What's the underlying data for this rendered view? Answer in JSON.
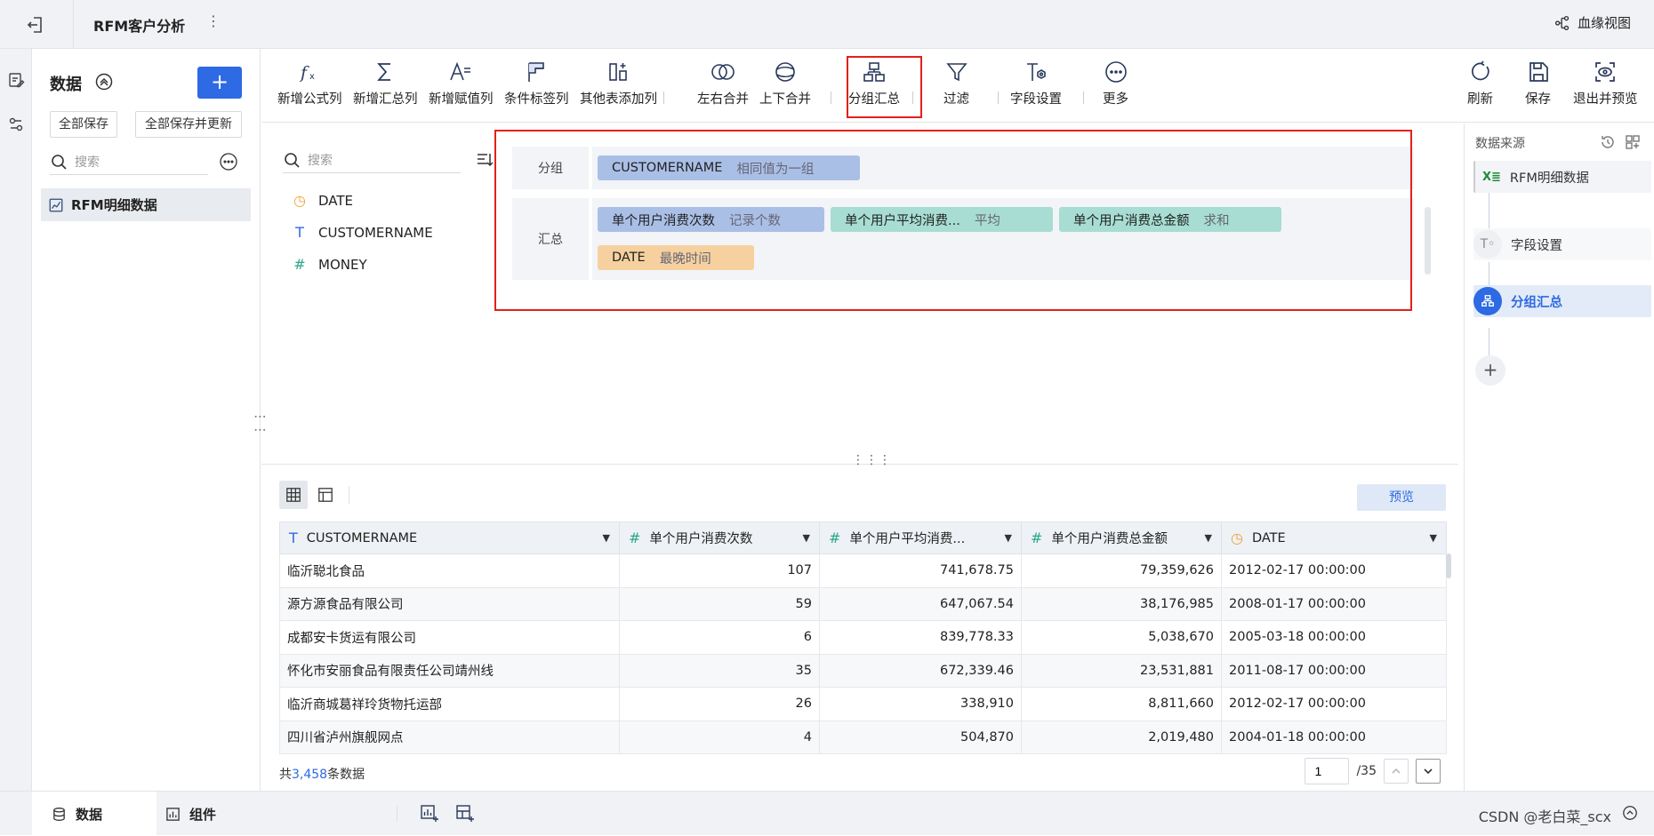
{
  "header": {
    "title": "RFM客户分析",
    "menu": "⋮",
    "lineage_label": "血缘视图"
  },
  "data_panel": {
    "title": "数据",
    "add": "+",
    "save_all": "全部保存",
    "save_all_update": "全部保存并更新",
    "search_placeholder": "搜索",
    "dataset": "RFM明细数据"
  },
  "toolbar": {
    "items": [
      {
        "label": "新增公式列",
        "icon": "formula-icon"
      },
      {
        "label": "新增汇总列",
        "icon": "sigma-icon"
      },
      {
        "label": "新增赋值列",
        "icon": "assign-icon"
      },
      {
        "label": "条件标签列",
        "icon": "flag-icon"
      },
      {
        "label": "其他表添加列",
        "icon": "add-column-icon"
      },
      {
        "label": "左右合并",
        "icon": "left-right-merge-icon"
      },
      {
        "label": "上下合并",
        "icon": "up-down-merge-icon"
      },
      {
        "label": "分组汇总",
        "icon": "group-summary-icon"
      },
      {
        "label": "过滤",
        "icon": "filter-icon"
      },
      {
        "label": "字段设置",
        "icon": "field-settings-icon"
      },
      {
        "label": "更多",
        "icon": "more-icon"
      }
    ],
    "right": [
      {
        "label": "刷新",
        "icon": "refresh-icon"
      },
      {
        "label": "保存",
        "icon": "save-icon"
      },
      {
        "label": "退出并预览",
        "icon": "exit-preview-icon"
      }
    ]
  },
  "fields": {
    "search_placeholder": "搜索",
    "items": [
      {
        "name": "DATE",
        "type": "date"
      },
      {
        "name": "CUSTOMERNAME",
        "type": "text"
      },
      {
        "name": "MONEY",
        "type": "number"
      }
    ]
  },
  "config": {
    "group_label": "分组",
    "group_chip": {
      "field": "CUSTOMERNAME",
      "sub": "相同值为一组"
    },
    "summary_label": "汇总",
    "summary_chips": [
      {
        "field": "单个用户消费次数",
        "sub": "记录个数"
      },
      {
        "field": "单个用户平均消费...",
        "sub": "平均"
      },
      {
        "field": "单个用户消费总金额",
        "sub": "求和"
      },
      {
        "field": "DATE",
        "sub": "最晚时间"
      }
    ]
  },
  "right_panel": {
    "title": "数据来源",
    "steps": [
      "RFM明细数据",
      "字段设置",
      "分组汇总"
    ],
    "add": "+"
  },
  "preview_button": "预览",
  "table": {
    "columns": [
      {
        "label": "CUSTOMERNAME",
        "type": "T"
      },
      {
        "label": "单个用户消费次数",
        "type": "#"
      },
      {
        "label": "单个用户平均消费...",
        "type": "#"
      },
      {
        "label": "单个用户消费总金额",
        "type": "#"
      },
      {
        "label": "DATE",
        "type": "date"
      }
    ],
    "rows": [
      [
        "临沂聪北食品",
        "107",
        "741,678.75",
        "79,359,626",
        "2012-02-17 00:00:00"
      ],
      [
        "源方源食品有限公司",
        "59",
        "647,067.54",
        "38,176,985",
        "2008-01-17 00:00:00"
      ],
      [
        "成都安卡货运有限公司",
        "6",
        "839,778.33",
        "5,038,670",
        "2005-03-18 00:00:00"
      ],
      [
        "怀化市安丽食品有限责任公司靖州线",
        "35",
        "672,339.46",
        "23,531,881",
        "2011-08-17 00:00:00"
      ],
      [
        "临沂商城葛祥玲货物托运部",
        "26",
        "338,910",
        "8,811,660",
        "2012-02-17 00:00:00"
      ],
      [
        "四川省泸州旗舰网点",
        "4",
        "504,870",
        "2,019,480",
        "2004-01-18 00:00:00"
      ]
    ]
  },
  "footer": {
    "prefix": "共",
    "count": "3,458",
    "suffix": "条数据",
    "page": "1",
    "total_pages": "/35"
  },
  "statusbar": {
    "tab_data": "数据",
    "tab_components": "组件",
    "watermark": "CSDN @老白菜_scx"
  },
  "colors": {
    "accent": "#2d6ae3",
    "highlight": "#e3201b"
  }
}
